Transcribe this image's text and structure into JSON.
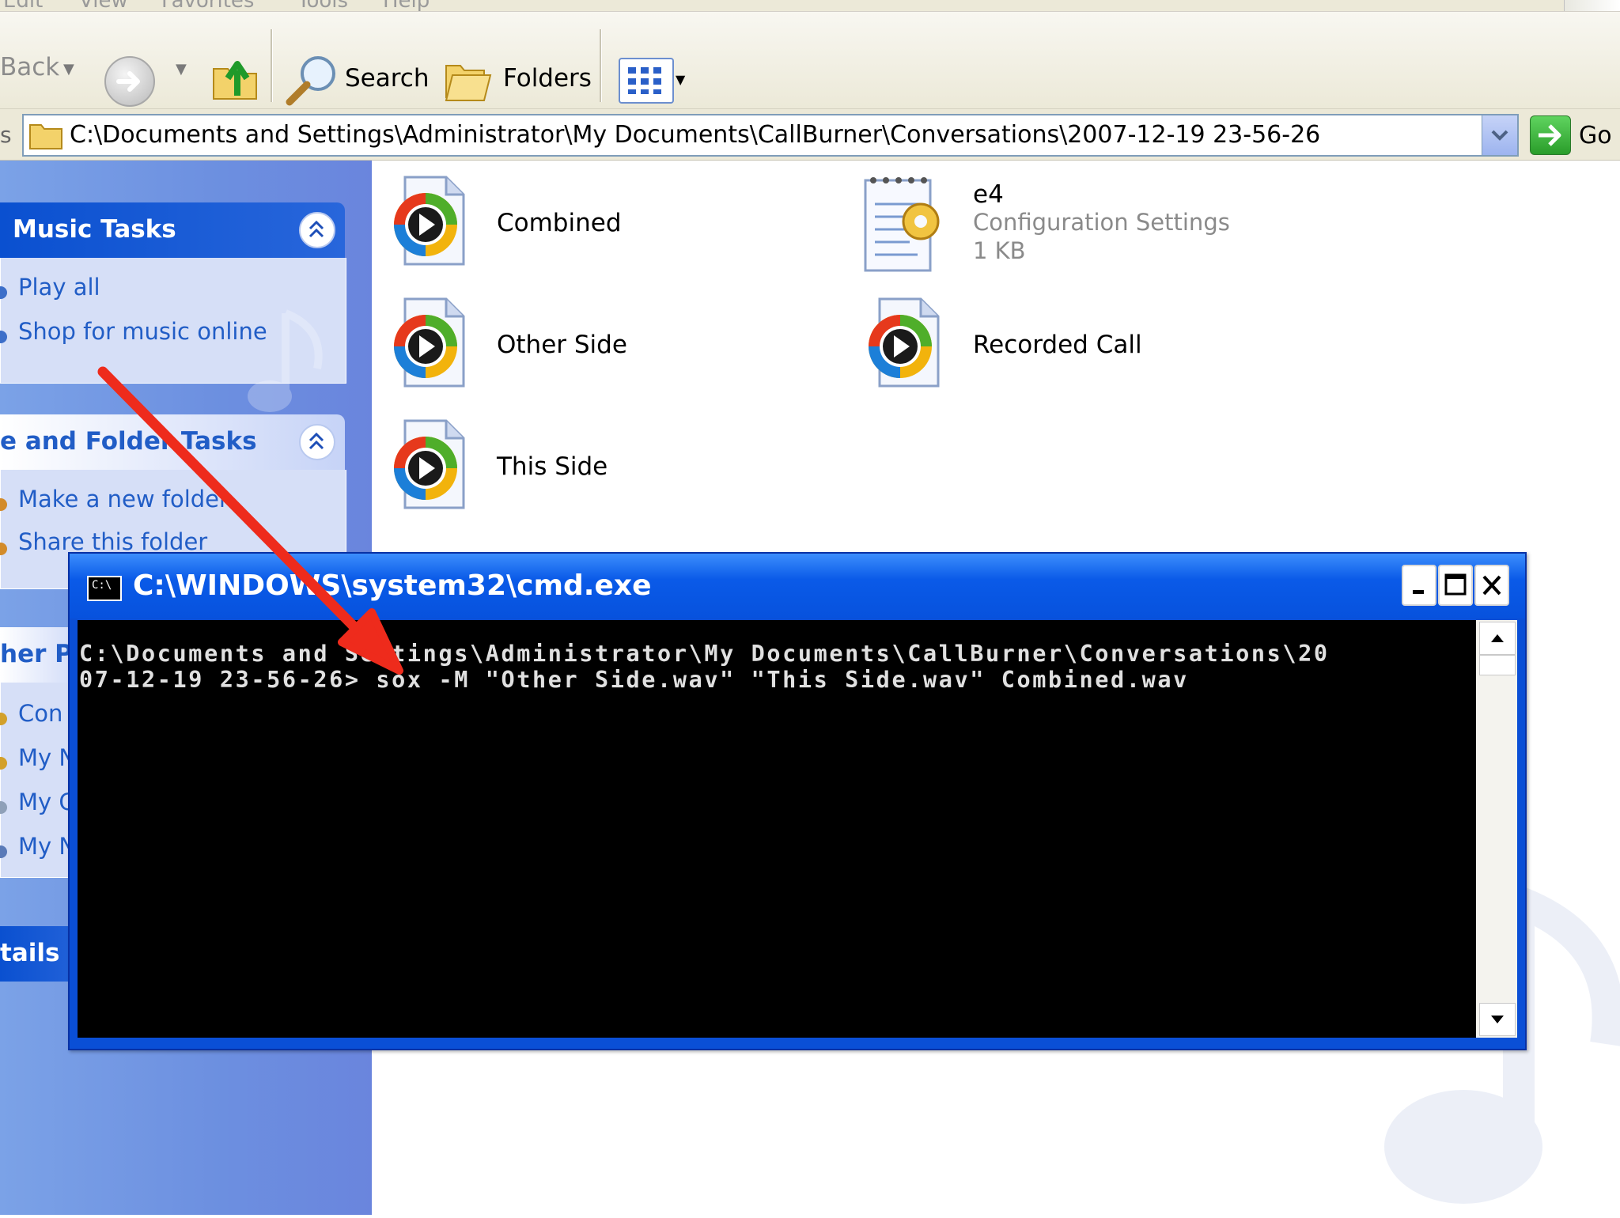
{
  "menubar": {
    "items": [
      "Edit",
      "View",
      "Favorites",
      "Tools",
      "Help"
    ]
  },
  "toolbar": {
    "back_label": "Back",
    "search_label": "Search",
    "folders_label": "Folders"
  },
  "address_bar": {
    "left_fragment": "s",
    "path": "C:\\Documents and Settings\\Administrator\\My Documents\\CallBurner\\Conversations\\2007-12-19 23-56-26",
    "go_label": "Go"
  },
  "task_pane": {
    "music_tasks": {
      "title": "Music Tasks",
      "items": [
        "Play all",
        "Shop for music online"
      ]
    },
    "file_folder_tasks": {
      "title": "e and Folder Tasks",
      "items": [
        "Make a new folder",
        "Share this folder"
      ]
    },
    "other_places": {
      "title": "her Pl",
      "items": [
        "Con",
        "My N",
        "My C",
        "My N"
      ]
    },
    "details": {
      "title": "tails"
    }
  },
  "files": [
    {
      "name": "Combined",
      "icon": "wav-media-icon"
    },
    {
      "name": "e4",
      "type": "Configuration Settings",
      "size": "1 KB",
      "icon": "config-file-icon"
    },
    {
      "name": "Other Side",
      "icon": "wav-media-icon"
    },
    {
      "name": "Recorded Call",
      "icon": "wav-media-icon"
    },
    {
      "name": "This Side",
      "icon": "wav-media-icon"
    }
  ],
  "cmd": {
    "title": "C:\\WINDOWS\\system32\\cmd.exe",
    "icon_text": "C:\\",
    "line1": "C:\\Documents and Settings\\Administrator\\My Documents\\CallBurner\\Conversations\\20",
    "line2": "07-12-19 23-56-26> sox -M \"Other Side.wav\" \"This Side.wav\" Combined.wav"
  },
  "colors": {
    "annotation_arrow": "#ee2b1c",
    "taskpane_bg": "#7ba2e7",
    "task_header": "#0a50d0",
    "cmd_titlebar": "#0a5ae8"
  }
}
